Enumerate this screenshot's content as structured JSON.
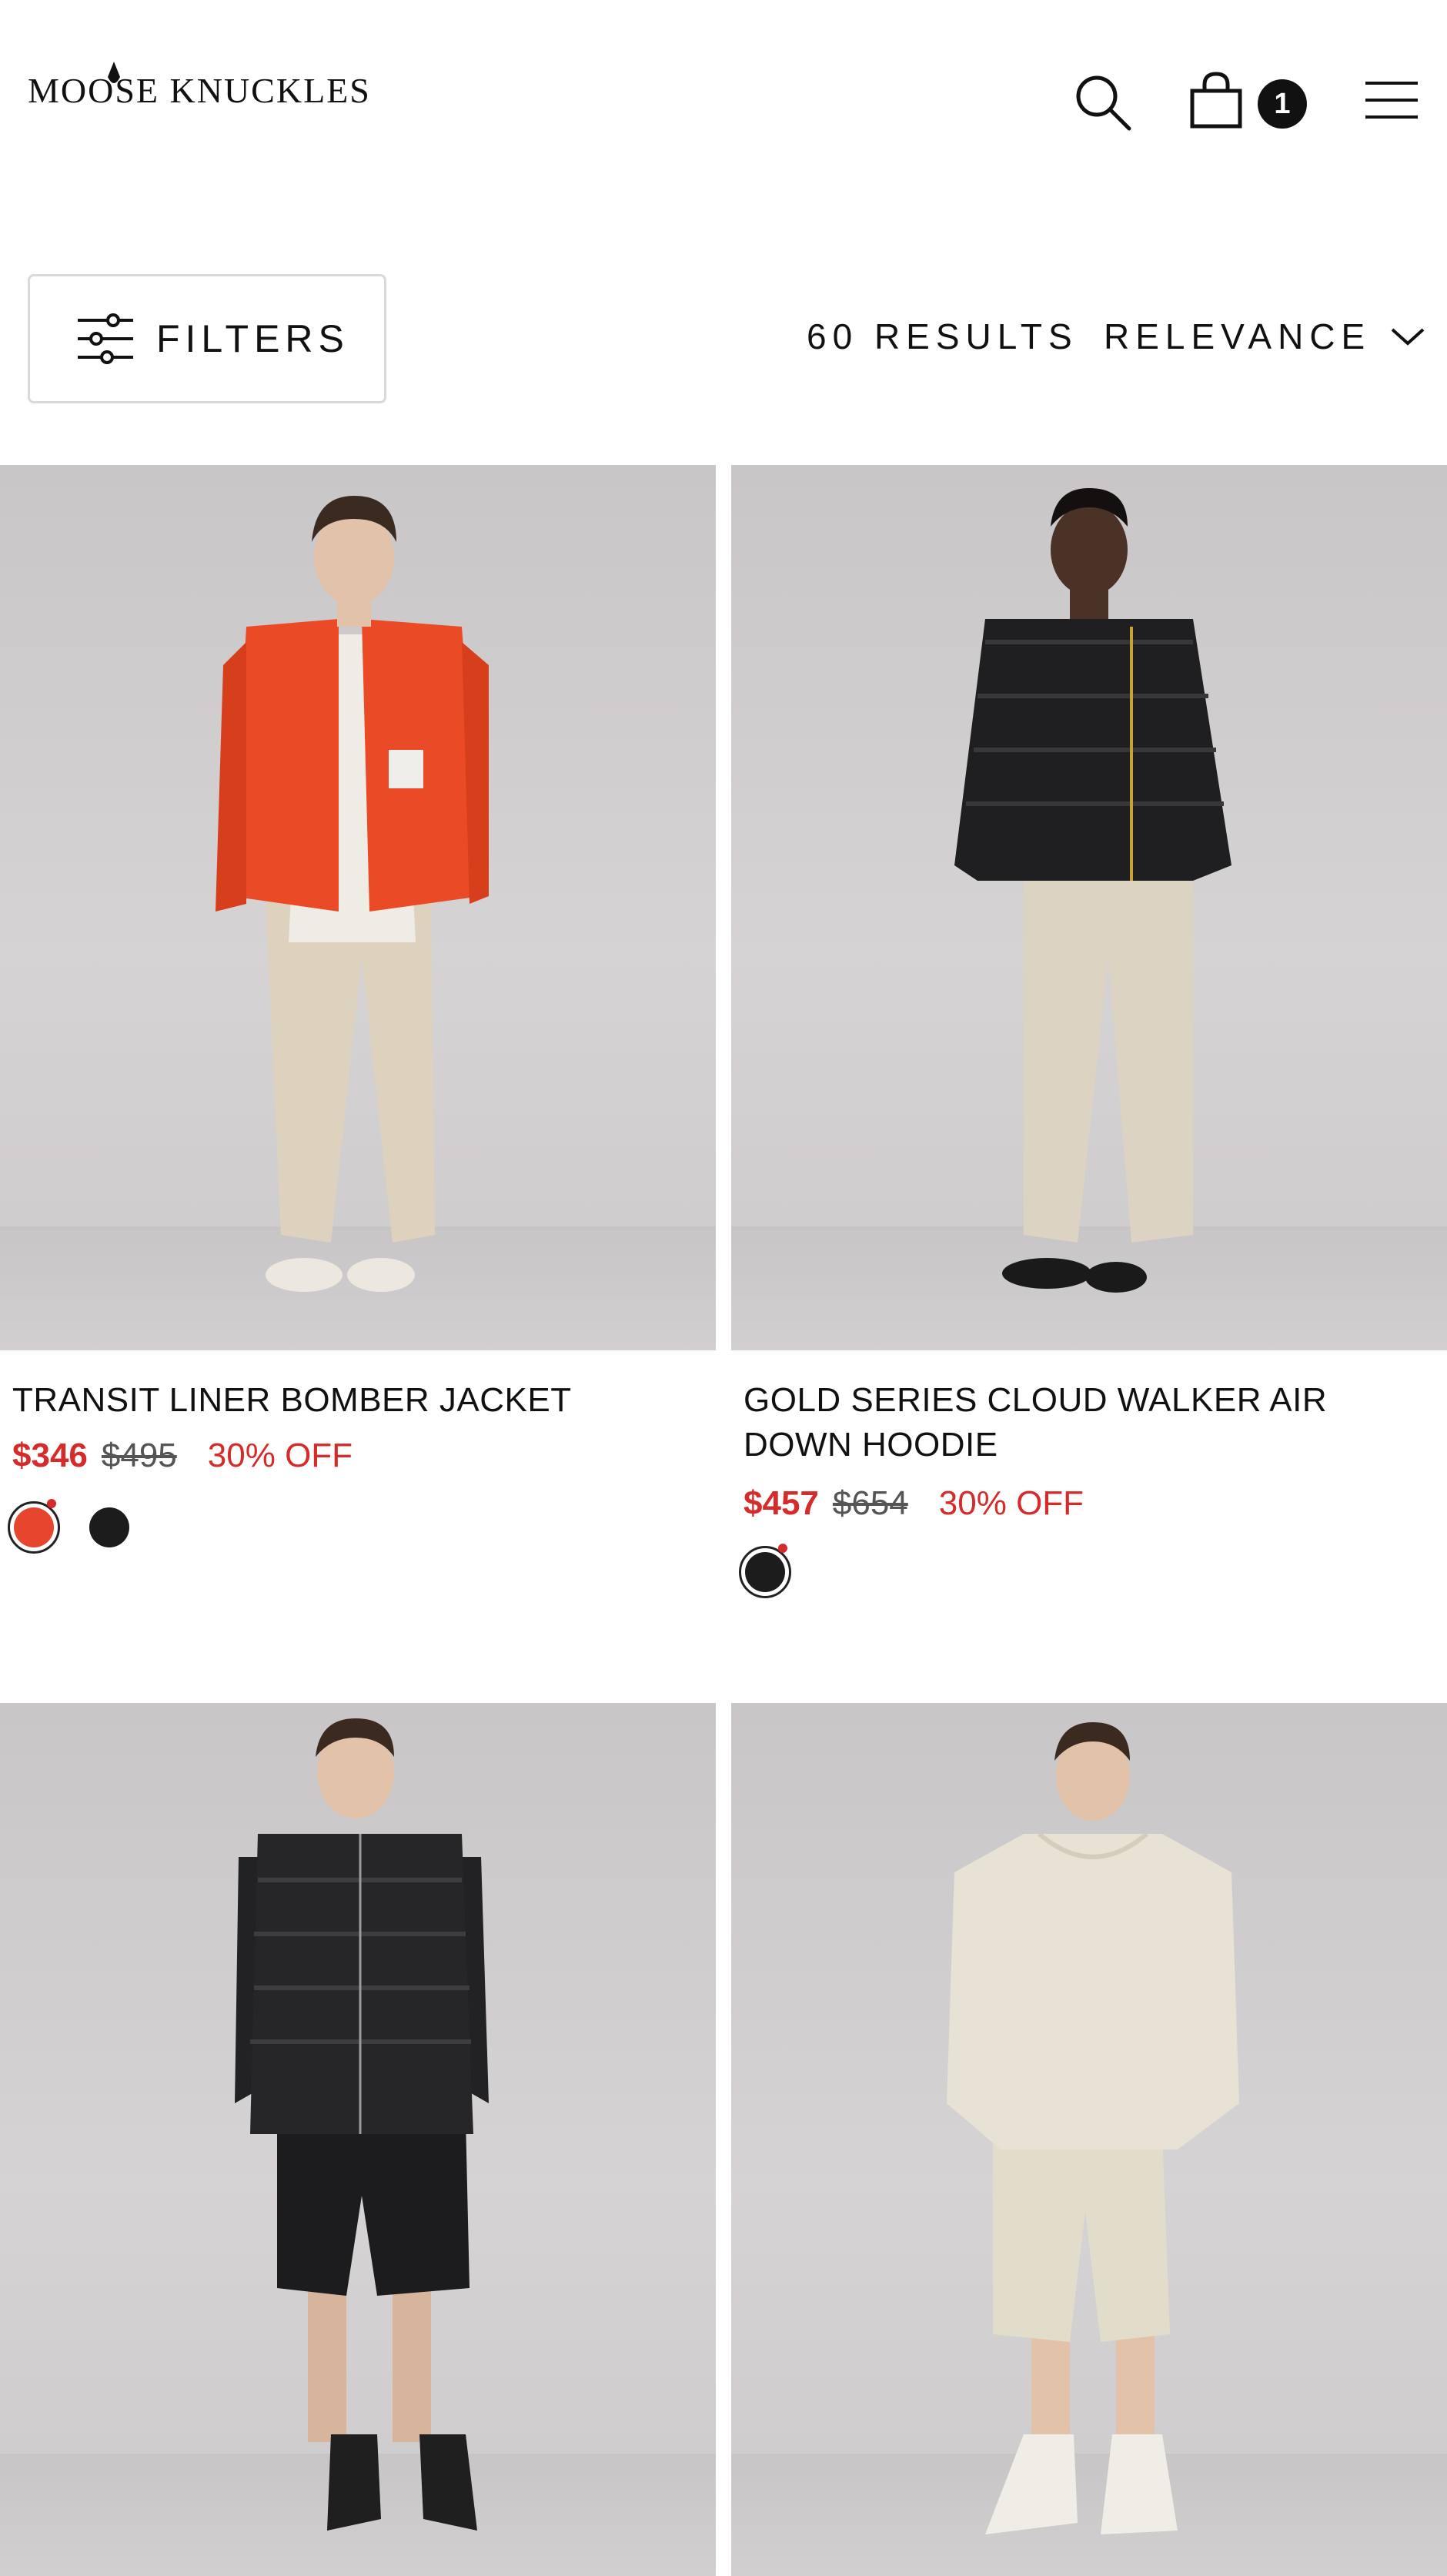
{
  "header": {
    "logo_text": "MOOSE KNUCKLES",
    "cart_count": "1"
  },
  "toolbar": {
    "filters_label": "FILTERS",
    "results_label": "60 RESULTS",
    "sort_label": "RELEVANCE"
  },
  "colors": {
    "sale_red": "#d52b2b",
    "swatch_red": "#e8452e",
    "swatch_black": "#1c1c1c"
  },
  "products": [
    {
      "title": "TRANSIT LINER BOMBER JACKET",
      "sale_price": "$346",
      "original_price": "$495",
      "discount": "30% OFF",
      "swatches": [
        "red",
        "black"
      ]
    },
    {
      "title": "GOLD SERIES CLOUD WALKER AIR DOWN HOODIE",
      "sale_price": "$457",
      "original_price": "$654",
      "discount": "30% OFF",
      "swatches": [
        "black"
      ]
    },
    {
      "title": "",
      "sale_price": "",
      "original_price": "",
      "discount": "",
      "swatches": []
    },
    {
      "title": "",
      "sale_price": "",
      "original_price": "",
      "discount": "",
      "swatches": []
    }
  ]
}
